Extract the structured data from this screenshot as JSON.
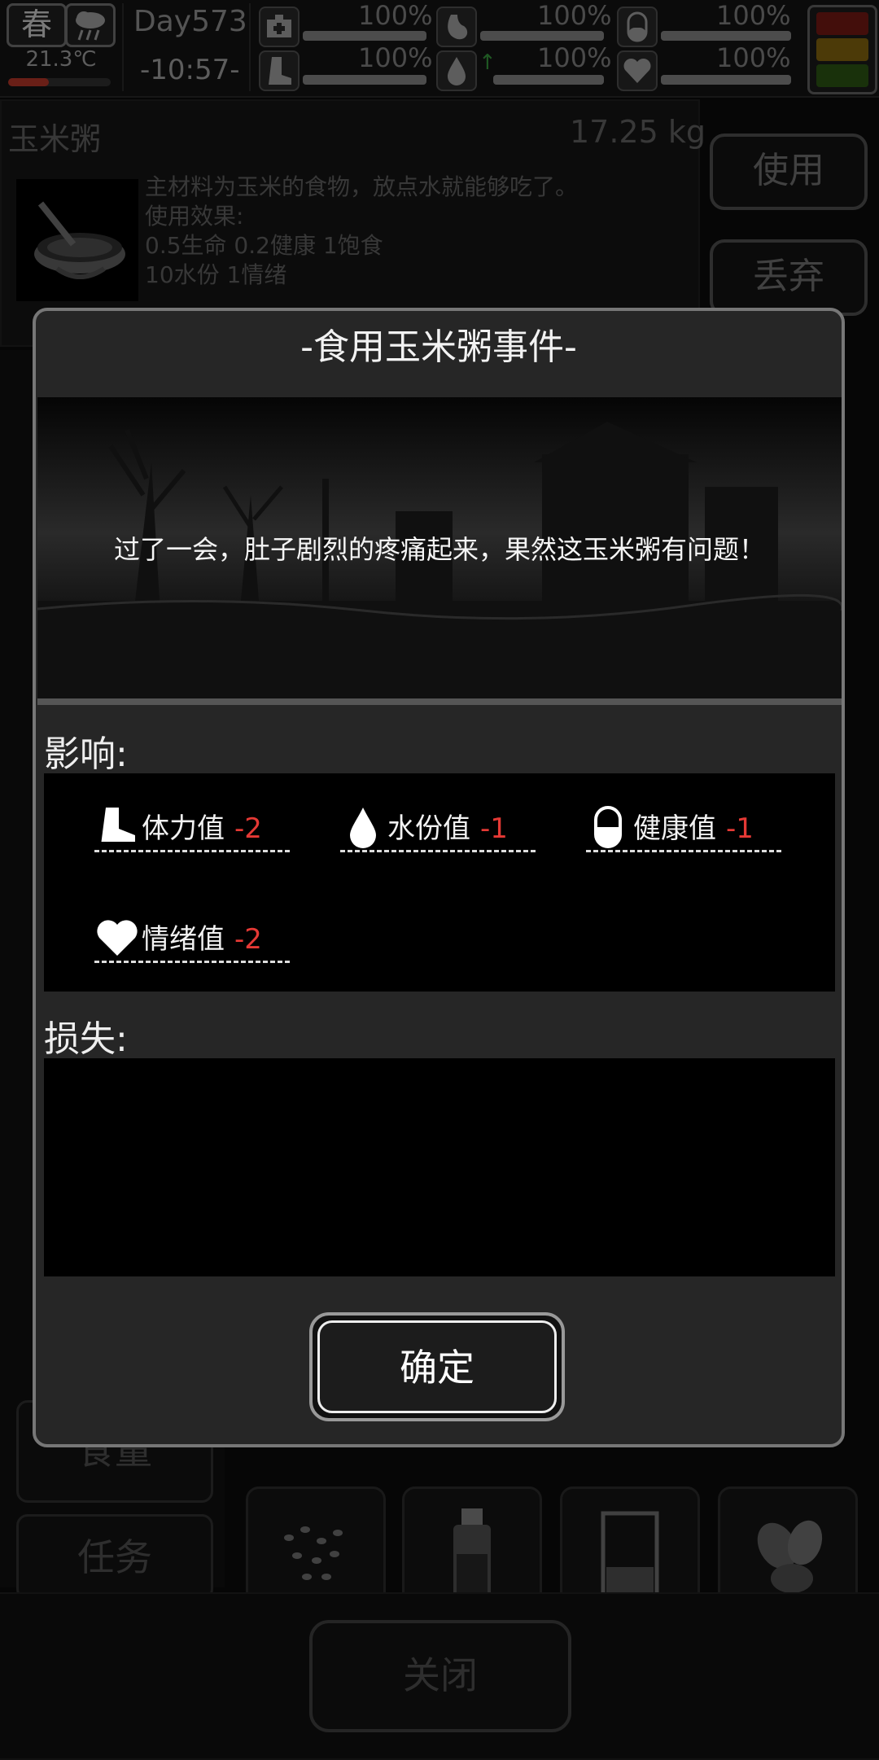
{
  "status": {
    "season": "春",
    "temperature": "21.3℃",
    "day": "Day573",
    "time": "-10:57-",
    "stats": [
      {
        "icon": "medkit-icon",
        "pct": "100%",
        "level": 1.0
      },
      {
        "icon": "stomach-icon",
        "pct": "100%",
        "level": 1.0
      },
      {
        "icon": "pill-icon",
        "pct": "100%",
        "level": 1.0
      },
      {
        "icon": "boot-icon",
        "pct": "100%",
        "level": 1.0
      },
      {
        "icon": "water-drop-icon",
        "pct": "100%",
        "level": 1.0
      },
      {
        "icon": "heart-icon",
        "pct": "100%",
        "level": 1.0
      }
    ]
  },
  "item": {
    "name": "玉米粥",
    "weight": "17.25 kg",
    "description": "主材料为玉米的食物，放点水就能够吃了。\n使用效果:\n0.5生命 0.2健康 1饱食\n10水份 1情绪",
    "use_label": "使用",
    "discard_label": "丢弃"
  },
  "background": {
    "tab_food": "食量",
    "tab_task": "任务",
    "close_label": "关闭"
  },
  "dialog": {
    "title": "-食用玉米粥事件-",
    "event_text": "过了一会，肚子剧烈的疼痛起来，果然这玉米粥有问题！",
    "effects_label": "影响:",
    "losses_label": "损失:",
    "effects": [
      {
        "icon": "boot-icon",
        "label": "体力值",
        "value": "-2"
      },
      {
        "icon": "water-drop-icon",
        "label": "水份值",
        "value": "-1"
      },
      {
        "icon": "pill-icon",
        "label": "健康值",
        "value": "-1"
      },
      {
        "icon": "heart-icon",
        "label": "情绪值",
        "value": "-2"
      }
    ],
    "confirm_label": "确定"
  },
  "colors": {
    "negative": "#e53935",
    "light_red": "#7a1a14",
    "light_yellow": "#8a6a10",
    "light_green": "#2f5a14"
  }
}
